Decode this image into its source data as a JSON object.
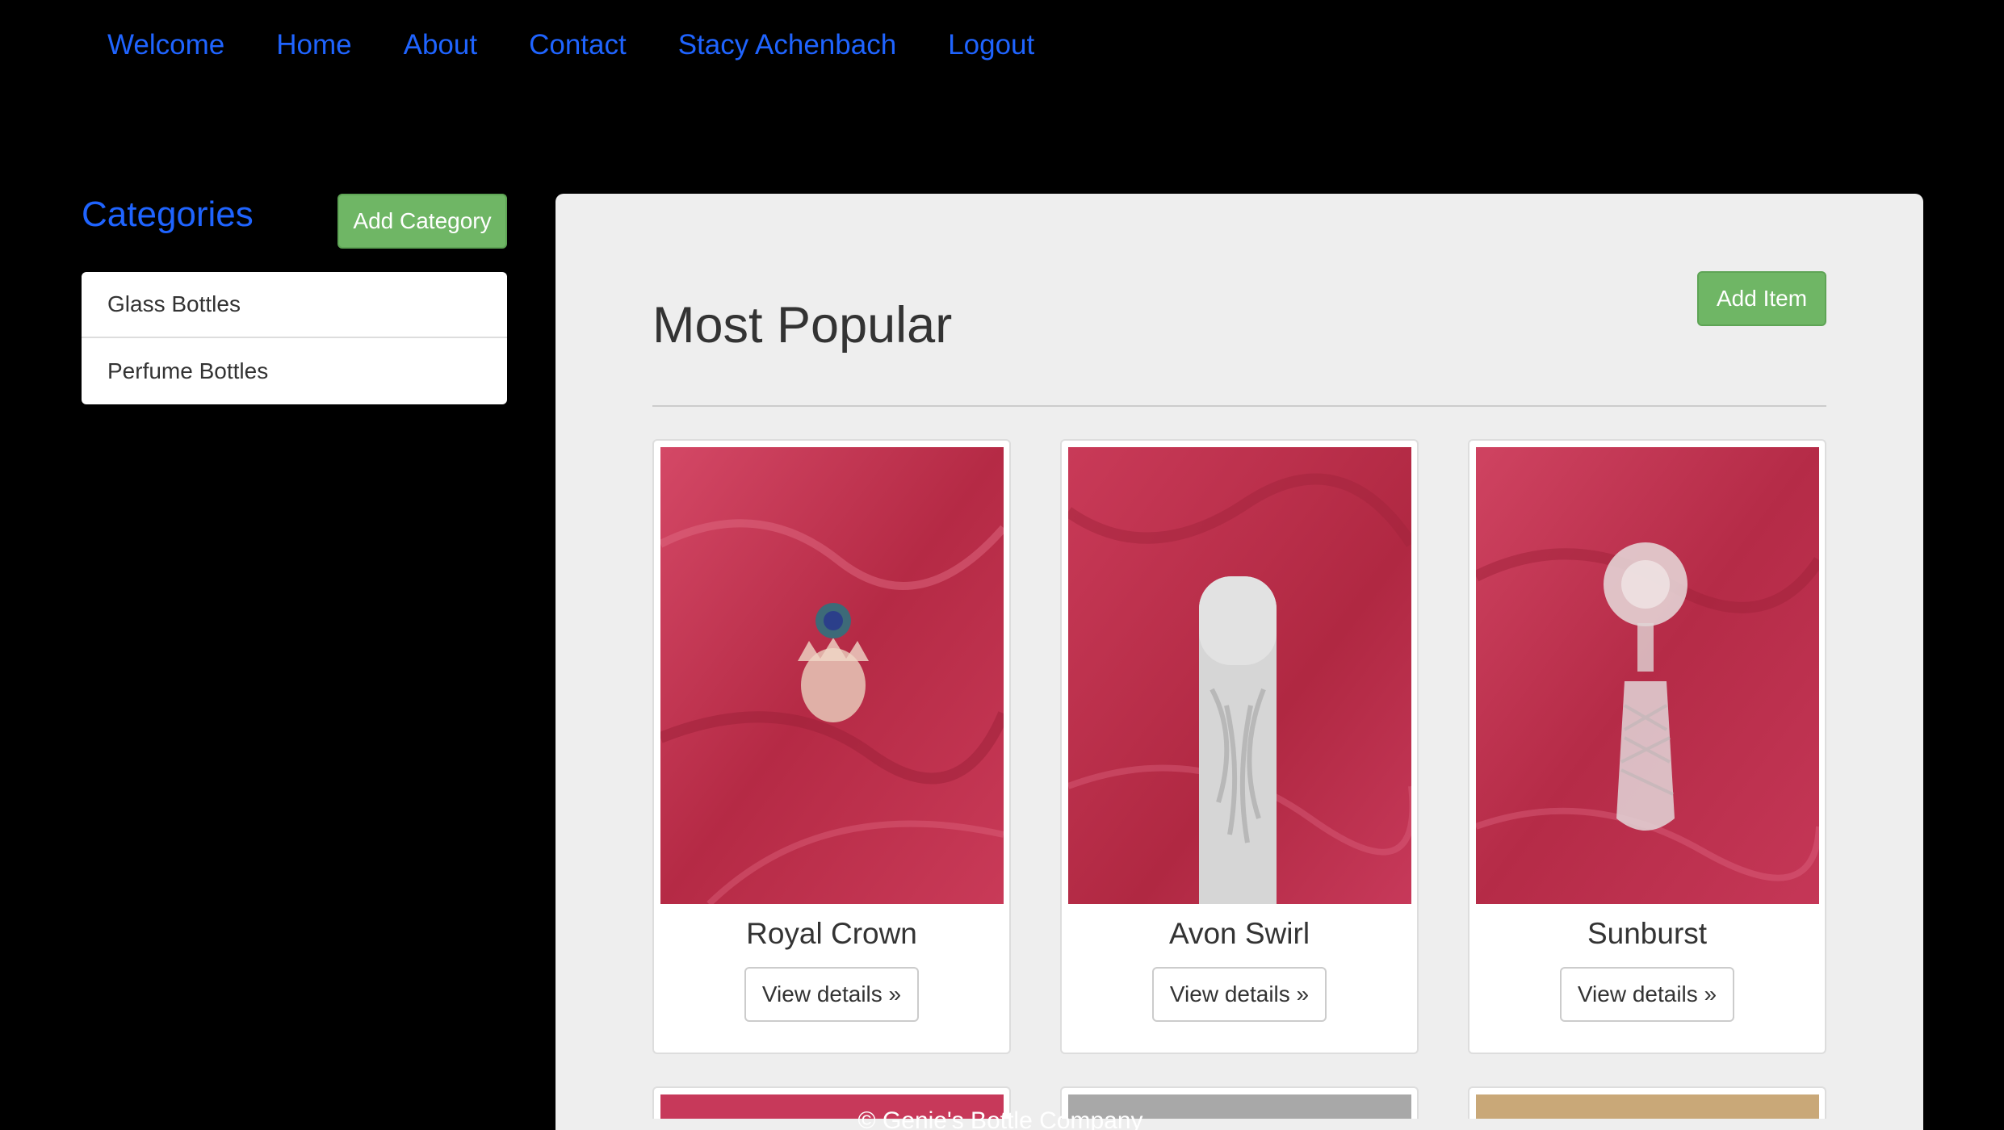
{
  "nav": {
    "items": [
      "Welcome",
      "Home",
      "About",
      "Contact",
      "Stacy Achenbach",
      "Logout"
    ]
  },
  "sidebar": {
    "title": "Categories",
    "add_label": "Add Category",
    "items": [
      "Glass Bottles",
      "Perfume Bottles"
    ]
  },
  "main": {
    "title": "Most Popular",
    "add_label": "Add Item",
    "view_label": "View details »",
    "products": [
      {
        "name": "Royal Crown"
      },
      {
        "name": "Avon Swirl"
      },
      {
        "name": "Sunburst"
      }
    ]
  },
  "footer": {
    "text": "© Genie's Bottle Company"
  },
  "colors": {
    "background": "#000000",
    "link": "#1f64ff",
    "success": "#6fb665",
    "panel": "#eeeeee",
    "photo_backdrop": "#c23a52"
  }
}
